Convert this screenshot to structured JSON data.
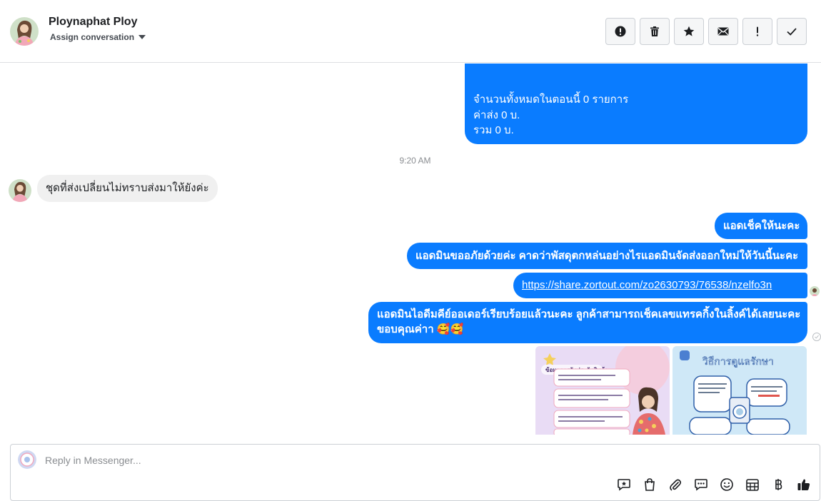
{
  "header": {
    "contact_name": "Ploynaphat Ploy",
    "assign_label": "Assign conversation",
    "actions": [
      {
        "name": "mark-spam-button",
        "icon": "alert-circle-icon"
      },
      {
        "name": "delete-button",
        "icon": "trash-icon"
      },
      {
        "name": "star-button",
        "icon": "star-icon"
      },
      {
        "name": "mark-unread-button",
        "icon": "envelope-icon"
      },
      {
        "name": "follow-up-button",
        "icon": "exclamation-icon"
      },
      {
        "name": "mark-done-button",
        "icon": "check-icon"
      }
    ]
  },
  "messages": {
    "summary_card": {
      "line1": "จำนวนทั้งหมดในตอนนี้ 0 รายการ",
      "line2": "ค่าส่ง 0 บ.",
      "line3": "รวม 0 บ."
    },
    "timestamp": "9:20 AM",
    "incoming": "ชุดที่ส่งเปลี่ยนไม่ทราบส่งมาให้ยังค่ะ",
    "outgoing_1": "แอดเช็คให้นะคะ",
    "outgoing_2": "แอดมินขออภัยด้วยค่ะ คาดว่าพัสดุตกหล่นอย่างไรแอดมินจัดส่งออกใหม่ให้วันนี้นะคะ",
    "outgoing_link": "https://share.zortout.com/zo2630793/76538/nzelfo3n",
    "outgoing_3_line1": "แอดมินไอดีมคีย์ออเดอร์เรียบร้อยแล้วนะคะ ลูกค้าสามารถเช็คเลขแทรคกิ้งในลิ้งค์ได้เลยนะคะ",
    "outgoing_3_line2": "ขอบคุณค่าา 🥰🥰",
    "image_1": {
      "title": "ข้อมูลการรับประกันสินค้า",
      "colors": {
        "bg": "#e9dcf5",
        "accent": "#f4c7d3"
      }
    },
    "image_2": {
      "title": "วิธีการดูแลรักษา",
      "colors": {
        "bg": "#cfe8f7",
        "accent": "#2f5fa8"
      }
    }
  },
  "composer": {
    "placeholder": "Reply in Messenger...",
    "tools": [
      {
        "name": "saved-reply-button",
        "icon": "chat-star-icon"
      },
      {
        "name": "shop-button",
        "icon": "shopping-bag-icon"
      },
      {
        "name": "attach-button",
        "icon": "paperclip-icon"
      },
      {
        "name": "faq-button",
        "icon": "chat-dots-icon"
      },
      {
        "name": "emoji-button",
        "icon": "smiley-icon"
      },
      {
        "name": "orders-button",
        "icon": "table-icon"
      },
      {
        "name": "payment-button",
        "icon": "baht-icon"
      },
      {
        "name": "like-button",
        "icon": "thumbs-up-icon"
      }
    ]
  },
  "colors": {
    "outgoing_bubble": "#0a7cff",
    "incoming_bubble": "#f0f0f0",
    "border": "#ccd0d5"
  }
}
